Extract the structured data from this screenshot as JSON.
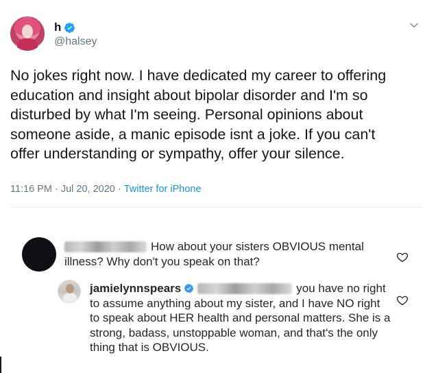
{
  "tweet": {
    "display_name": "h",
    "handle": "@halsey",
    "text": "No jokes right now. I have dedicated my career to offering\neducation and insight about bipolar disorder and I'm so\ndisturbed by what I'm seeing. Personal opinions about\nsomeone aside, a manic episode isnt a joke. If you can't\noffer understanding or sympathy, offer your silence.",
    "time": "11:16 PM",
    "separator": "·",
    "date": "Jul 20, 2020",
    "source": "Twitter for iPhone",
    "verified_icon": "verified-badge-icon",
    "more_icon": "chevron-down-icon"
  },
  "comments": [
    {
      "username_redacted": true,
      "avatar": "black-circle",
      "text": "How about your sisters OBVIOUS mental illness? Why don't you speak on that?",
      "like_icon": "heart-outline-icon"
    },
    {
      "username": "jamielynnspears",
      "verified": true,
      "mention_redacted": true,
      "text": "you have no right to assume anything about my sister, and I have NO right to speak about HER health and personal matters. She is a strong, badass, unstoppable woman, and that's the only thing that is OBVIOUS.",
      "like_icon": "heart-outline-icon"
    }
  ],
  "colors": {
    "twitter_blue": "#1da1f2",
    "link_blue": "#1b95e0",
    "secondary_text": "#657786",
    "ig_text": "#262626",
    "ig_verified": "#3897f0"
  }
}
